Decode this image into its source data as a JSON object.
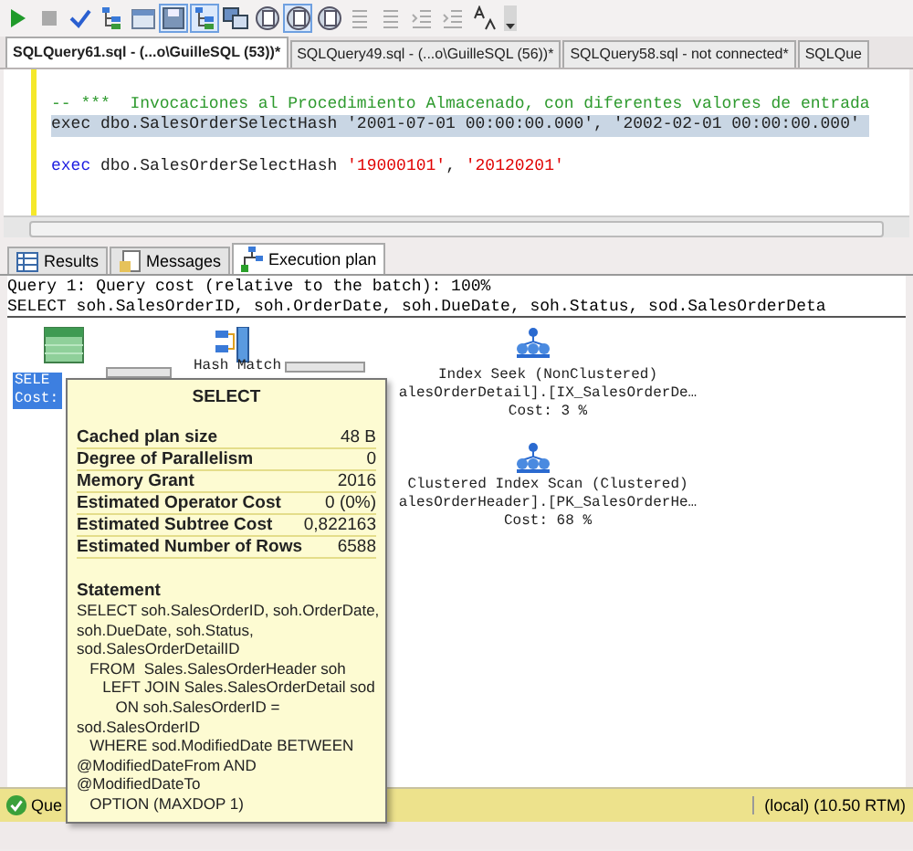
{
  "toolbar": [
    {
      "kind": "play",
      "on": false
    },
    {
      "kind": "stop",
      "on": false
    },
    {
      "kind": "check",
      "on": false
    },
    {
      "kind": "tree",
      "on": false
    },
    {
      "kind": "window",
      "on": false
    },
    {
      "kind": "save",
      "on": true
    },
    {
      "kind": "tree",
      "on": true
    },
    {
      "kind": "windows",
      "on": false
    },
    {
      "kind": "doc",
      "on": false
    },
    {
      "kind": "doc",
      "on": true
    },
    {
      "kind": "doc",
      "on": false
    },
    {
      "kind": "list",
      "on": false
    },
    {
      "kind": "list",
      "on": false
    },
    {
      "kind": "indent",
      "on": false
    },
    {
      "kind": "indent",
      "on": false
    },
    {
      "kind": "font",
      "on": false
    }
  ],
  "document_tabs": [
    {
      "label": "SQLQuery61.sql - (...o\\GuilleSQL (53))*",
      "selected": true
    },
    {
      "label": "SQLQuery49.sql - (...o\\GuilleSQL (56))*",
      "selected": false
    },
    {
      "label": "SQLQuery58.sql - not connected*",
      "selected": false
    },
    {
      "label": "SQLQue",
      "selected": false
    }
  ],
  "editor": {
    "lines": [
      {
        "kind": "blank"
      },
      {
        "kind": "code",
        "highlighted": false,
        "tokens": [
          {
            "kind": "comment",
            "text": "-- ***  Invocaciones al Procedimiento Almacenado, con diferentes valores de entrada"
          }
        ]
      },
      {
        "kind": "code",
        "highlighted": true,
        "tokens": [
          {
            "kind": "plain",
            "text": "exec dbo.SalesOrderSelectHash '2001-07-01 00:00:00.000', '2002-02-01 00:00:00.000'"
          }
        ]
      },
      {
        "kind": "blank"
      },
      {
        "kind": "code",
        "highlighted": false,
        "tokens": [
          {
            "kind": "keyword",
            "text": "exec"
          },
          {
            "kind": "plain",
            "text": " dbo.SalesOrderSelectHash "
          },
          {
            "kind": "string",
            "text": "'19000101'"
          },
          {
            "kind": "plain",
            "text": ", "
          },
          {
            "kind": "string",
            "text": "'20120201'"
          }
        ]
      }
    ]
  },
  "result_tabs": [
    {
      "label": "Results",
      "kind": "grid",
      "selected": false
    },
    {
      "label": "Messages",
      "kind": "doc",
      "selected": false
    },
    {
      "label": "Execution plan",
      "kind": "plan",
      "selected": true
    }
  ],
  "plan_header": [
    "Query 1: Query cost (relative to the batch): 100%",
    "SELECT soh.SalesOrderID, soh.OrderDate, soh.DueDate, soh.Status, sod.SalesOrderDeta"
  ],
  "plan_nodes": [
    {
      "kind": "select",
      "selected": true,
      "lines": [
        "SELE",
        "Cost:"
      ]
    },
    {
      "kind": "hash",
      "selected": false,
      "lines": [
        "Hash Match"
      ]
    },
    {
      "kind": "seek",
      "selected": false,
      "lines": [
        "Index Seek (NonClustered)",
        "alesOrderDetail].[IX_SalesOrderDe…",
        "Cost: 3 %"
      ]
    },
    {
      "kind": "scan",
      "selected": false,
      "lines": [
        "Clustered Index Scan (Clustered)",
        "alesOrderHeader].[PK_SalesOrderHe…",
        "Cost: 68 %"
      ]
    }
  ],
  "tooltip": {
    "title": "SELECT",
    "properties": [
      {
        "label": "Cached plan size",
        "value": "48 B"
      },
      {
        "label": "Degree of Parallelism",
        "value": "0"
      },
      {
        "label": "Memory Grant",
        "value": "2016"
      },
      {
        "label": "Estimated Operator Cost",
        "value": "0 (0%)"
      },
      {
        "label": "Estimated Subtree Cost",
        "value": "0,822163"
      },
      {
        "label": "Estimated Number of Rows",
        "value": "6588"
      }
    ],
    "statement_label": "Statement",
    "statement": "SELECT soh.SalesOrderID, soh.OrderDate,\nsoh.DueDate, soh.Status,\nsod.SalesOrderDetailID\n   FROM  Sales.SalesOrderHeader soh\n      LEFT JOIN Sales.SalesOrderDetail sod\n         ON soh.SalesOrderID =\nsod.SalesOrderID\n   WHERE sod.ModifiedDate BETWEEN\n@ModifiedDateFrom AND\n@ModifiedDateTo\n   OPTION (MAXDOP 1)"
  },
  "status_bar": {
    "message": "Que",
    "server": "(local) (10.50 RTM)"
  }
}
